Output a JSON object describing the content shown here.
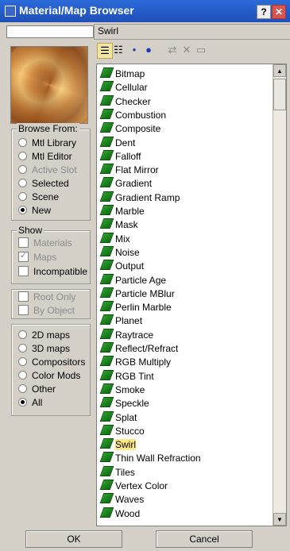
{
  "window": {
    "title": "Material/Map Browser",
    "help_label": "?",
    "close_label": "✕"
  },
  "search": {
    "value": ""
  },
  "name_field": {
    "value": "Swirl"
  },
  "browse_from": {
    "title": "Browse From:",
    "options": [
      {
        "label": "Mtl Library",
        "selected": false,
        "disabled": false
      },
      {
        "label": "Mtl Editor",
        "selected": false,
        "disabled": false
      },
      {
        "label": "Active Slot",
        "selected": false,
        "disabled": true
      },
      {
        "label": "Selected",
        "selected": false,
        "disabled": false
      },
      {
        "label": "Scene",
        "selected": false,
        "disabled": false
      },
      {
        "label": "New",
        "selected": true,
        "disabled": false
      }
    ]
  },
  "show": {
    "title": "Show",
    "options": [
      {
        "label": "Materials",
        "checked": false,
        "disabled": true
      },
      {
        "label": "Maps",
        "checked": true,
        "disabled": true
      },
      {
        "label": "Incompatible",
        "checked": false,
        "disabled": false
      }
    ]
  },
  "scope": {
    "options": [
      {
        "label": "Root Only",
        "checked": false,
        "disabled": true
      },
      {
        "label": "By Object",
        "checked": false,
        "disabled": true
      }
    ]
  },
  "map_types": {
    "options": [
      {
        "label": "2D maps",
        "selected": false
      },
      {
        "label": "3D maps",
        "selected": false
      },
      {
        "label": "Compositors",
        "selected": false
      },
      {
        "label": "Color Mods",
        "selected": false
      },
      {
        "label": "Other",
        "selected": false
      },
      {
        "label": "All",
        "selected": true
      }
    ]
  },
  "toolbar": {
    "buttons": [
      {
        "icon": "list-view-icon",
        "glyph": "☰"
      },
      {
        "icon": "list-icons-view-icon",
        "glyph": "☷"
      },
      {
        "icon": "small-icons-view-icon",
        "glyph": "•"
      },
      {
        "icon": "large-icons-view-icon",
        "glyph": "●"
      },
      {
        "icon": "update-scene-icon",
        "glyph": "⇄"
      },
      {
        "icon": "delete-icon",
        "glyph": "✕"
      },
      {
        "icon": "clear-library-icon",
        "glyph": "▭"
      }
    ]
  },
  "maps": [
    "Bitmap",
    "Cellular",
    "Checker",
    "Combustion",
    "Composite",
    "Dent",
    "Falloff",
    "Flat Mirror",
    "Gradient",
    "Gradient Ramp",
    "Marble",
    "Mask",
    "Mix",
    "Noise",
    "Output",
    "Particle Age",
    "Particle MBlur",
    "Perlin Marble",
    "Planet",
    "Raytrace",
    "Reflect/Refract",
    "RGB Multiply",
    "RGB Tint",
    "Smoke",
    "Speckle",
    "Splat",
    "Stucco",
    "Swirl",
    "Thin Wall Refraction",
    "Tiles",
    "Vertex Color",
    "Waves",
    "Wood"
  ],
  "selected_map": "Swirl",
  "buttons": {
    "ok": "OK",
    "cancel": "Cancel"
  },
  "colors": {
    "titlebar": "#1f4fb8",
    "selection": "#ffe885",
    "map_icon": "#2e9e2e"
  }
}
